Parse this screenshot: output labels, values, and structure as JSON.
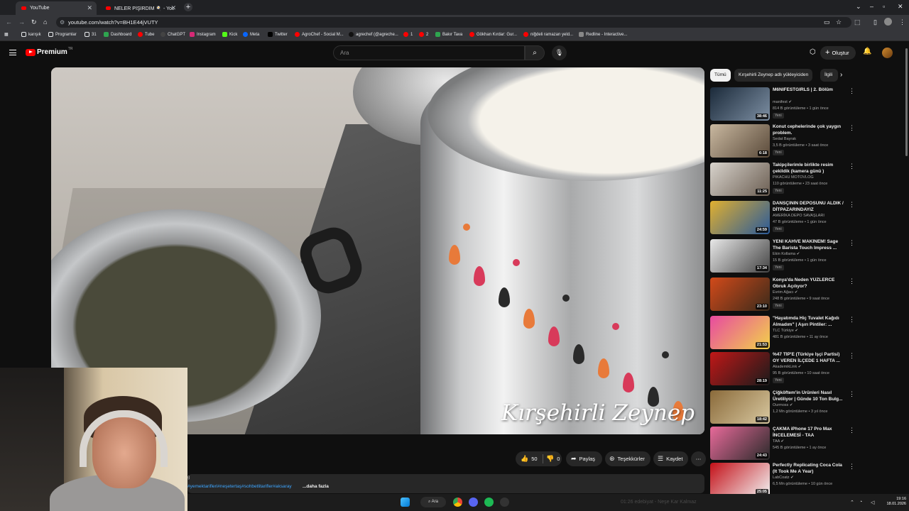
{
  "browser": {
    "tabs": [
      {
        "label": "YouTube",
        "active": true
      },
      {
        "label": "NELER PİŞİRDİM 🍳 - YouTu...",
        "active": false
      }
    ],
    "url": "youtube.com/watch?v=BH1E44jVUTY",
    "bookmarks": [
      {
        "label": "karışık",
        "color": "#e8eaed"
      },
      {
        "label": "Programlar",
        "color": "#e8eaed"
      },
      {
        "label": "31",
        "color": "#e8eaed"
      },
      {
        "label": "Dashboard",
        "color": "#2ea44f"
      },
      {
        "label": "Tube",
        "color": "#ff0000"
      },
      {
        "label": "ChatGPT",
        "color": "#444444"
      },
      {
        "label": "Instagram",
        "color": "#d62976"
      },
      {
        "label": "Kick",
        "color": "#53fc18"
      },
      {
        "label": "Meta",
        "color": "#0866ff"
      },
      {
        "label": "Twitter",
        "color": "#000000"
      },
      {
        "label": "AgroChef - Social M...",
        "color": "#ff0000"
      },
      {
        "label": "agrechef (@agreche...",
        "color": "#111111"
      },
      {
        "label": "1",
        "color": "#ff0000"
      },
      {
        "label": "2",
        "color": "#ff0000"
      },
      {
        "label": "Bakır Tava",
        "color": "#2ea44f"
      },
      {
        "label": "Gökhan Kırdar: Gur...",
        "color": "#ff0000"
      },
      {
        "label": "niğdeli ramazan yeld...",
        "color": "#ff0000"
      },
      {
        "label": "Redline - Interactive...",
        "color": "#888888"
      }
    ]
  },
  "youtube": {
    "logo_text": "Premium",
    "logo_region": "TR",
    "search_placeholder": "Ara",
    "create_label": "Oluştur"
  },
  "video": {
    "watermark": "Kırşehirli Zeynep",
    "likes": "50",
    "dislikes": "0",
    "share_label": "Paylaş",
    "thanks_label": "Teşekkürler",
    "save_label": "Kaydet",
    "description_tags": "#yemektarifleri#neşetertaş#sohbetlitarifler#aksaray",
    "description_more": "...daha fazla",
    "description_prefix": "g"
  },
  "sidebar": {
    "chips": [
      {
        "label": "Tümü",
        "selected": true
      },
      {
        "label": "Kırşehirli Zeynep adlı yükleyiciden",
        "selected": false
      },
      {
        "label": "İlgili",
        "selected": false
      }
    ],
    "recommendations": [
      {
        "title": "M6NIFESTGIRLS | 2. Bölüm",
        "channel": "manifest",
        "verified": true,
        "meta": "814 B görüntüleme • 1 gün önce",
        "badge": "Yeni",
        "duration": "38:46",
        "thumb_colors": [
          "#1b2a3a",
          "#7d8fa3"
        ]
      },
      {
        "title": "Konut cephelerinde çok yaygın problem.",
        "channel": "Sedat Bayrak",
        "verified": false,
        "meta": "3,5 B görüntüleme • 3 saat önce",
        "badge": "Yeni",
        "duration": "6:18",
        "thumb_colors": [
          "#c9b8a0",
          "#5a4a3a"
        ]
      },
      {
        "title": "Takipçilerimle birlikte resim çekildik (kamera günü )",
        "channel": "PIKACHU MOTOVLOG",
        "verified": false,
        "meta": "110 görüntüleme • 23 saat önce",
        "badge": "Yeni",
        "duration": "11:25",
        "thumb_colors": [
          "#d8d3cc",
          "#6b5e52"
        ]
      },
      {
        "title": "DANSÇININ DEPOSUNU ALDIK / DİTPAZARINDAYIZ",
        "channel": "AMERİKA DEPO SAVAŞLARI",
        "verified": false,
        "meta": "47 B görüntüleme • 1 gün önce",
        "badge": "Yeni",
        "duration": "24:59",
        "thumb_colors": [
          "#e0b030",
          "#2a5a9a"
        ]
      },
      {
        "title": "YENİ KAHVE MAKİNEM! Sage The Barista Touch Impress ...",
        "channel": "Ekin Kollama",
        "verified": true,
        "meta": "15 B görüntüleme • 1 gün önce",
        "badge": "Yeni",
        "duration": "17:34",
        "thumb_colors": [
          "#e8e8e8",
          "#444444"
        ]
      },
      {
        "title": "Konya'da Neden YÜZLERCE Obruk Açılıyor?",
        "channel": "Evrim Ağacı",
        "verified": true,
        "meta": "248 B görüntüleme • 9 saat önce",
        "badge": "Yeni",
        "duration": "23:10",
        "thumb_colors": [
          "#d24a1a",
          "#3a2a1a"
        ]
      },
      {
        "title": "\"Hayatımda Hiç Tuvalet Kağıdı Almadım\" | Aşırı Pintiler: ...",
        "channel": "TLC Türkiye",
        "verified": true,
        "meta": "481 B görüntüleme • 11 ay önce",
        "badge": "",
        "duration": "21:53",
        "thumb_colors": [
          "#e84aa0",
          "#f2d24a"
        ]
      },
      {
        "title": "%47 TİP'E (Türkiye İşçi Partisi) OY VEREN İLÇEDE 1 HAFTA ...",
        "channel": "AkademikLink",
        "verified": true,
        "meta": "95 B görüntüleme • 10 saat önce",
        "badge": "Yeni",
        "duration": "28:19",
        "thumb_colors": [
          "#c01818",
          "#1a1a1a"
        ]
      },
      {
        "title": "Çiğköftem'in Ürünleri Nasıl Üretiliyor | Günde 10 Ton Bulg...",
        "channel": "Ourmoss",
        "verified": true,
        "meta": "1,2 Mn görüntüleme • 3 yıl önce",
        "badge": "",
        "duration": "18:42",
        "thumb_colors": [
          "#8a6a3a",
          "#d8c8a0"
        ]
      },
      {
        "title": "ÇAKMA iPhone 17 Pro Max İNCELEMESİ - TAA",
        "channel": "TAA",
        "verified": true,
        "meta": "545 B görüntüleme • 1 ay önce",
        "badge": "",
        "duration": "24:43",
        "thumb_colors": [
          "#e86a9a",
          "#2a2a2a"
        ]
      },
      {
        "title": "Perfectly Replicating Coca Cola (It Took Me A Year)",
        "channel": "LabCoatz",
        "verified": true,
        "meta": "6,5 Mn görüntüleme • 10 gün önce",
        "badge": "",
        "duration": "25:05",
        "thumb_colors": [
          "#c41018",
          "#f2f2f2"
        ]
      }
    ]
  },
  "taskbar": {
    "search_label": "Ara",
    "time": "19:16",
    "date": "18.01.2026",
    "ghost_text": "01:26 edebiyat - Neşe Kar Kalmaz"
  }
}
